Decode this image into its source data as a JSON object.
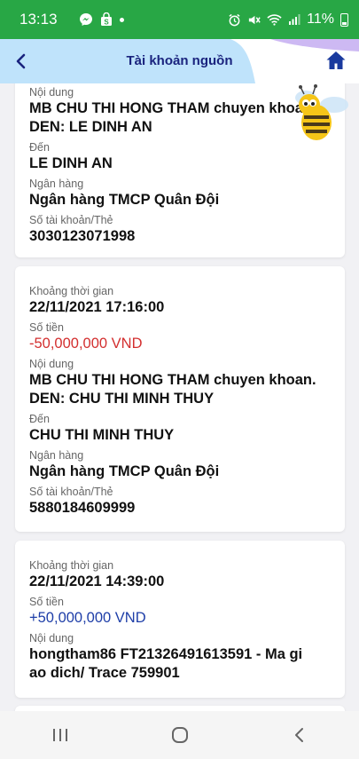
{
  "statusbar": {
    "time": "13:13",
    "battery": "11%",
    "icons": [
      "messenger-icon",
      "bag-icon",
      "dot-icon",
      "alarm-icon",
      "mute-icon",
      "wifi-icon",
      "signal-icon",
      "battery-icon"
    ]
  },
  "header": {
    "title": "Tài khoản nguồn",
    "back_icon": "chevron-left-icon",
    "home_icon": "home-icon"
  },
  "transactions": [
    {
      "content_label": "Nội dung",
      "content": "MB CHU THI HONG THAM chuyen khoan. DEN: LE DINH AN",
      "to_label": "Đến",
      "to": "LE DINH AN",
      "bank_label": "Ngân hàng",
      "bank": "Ngân hàng TMCP Quân Đội",
      "account_label": "Số tài khoản/Thẻ",
      "account": "3030123071998"
    },
    {
      "time_label": "Khoảng thời gian",
      "time": "22/11/2021 17:16:00",
      "amount_label": "Số tiền",
      "amount": "-50,000,000 VND",
      "content_label": "Nội dung",
      "content": "MB CHU THI HONG THAM chuyen khoan. DEN: CHU THI MINH THUY",
      "to_label": "Đến",
      "to": "CHU THI MINH THUY",
      "bank_label": "Ngân hàng",
      "bank": "Ngân hàng TMCP Quân Đội",
      "account_label": "Số tài khoản/Thẻ",
      "account": "5880184609999"
    },
    {
      "time_label": "Khoảng thời gian",
      "time": "22/11/2021 14:39:00",
      "amount_label": "Số tiền",
      "amount": "+50,000,000 VND",
      "content_label": "Nội dung",
      "content": "hongtham86 FT21326491613591 - Ma gi ao dich/ Trace 759901"
    }
  ],
  "colors": {
    "statusbar": "#28a745",
    "title": "#1a237e",
    "negative": "#d32f2f",
    "positive": "#1e3ea8"
  },
  "navbar": {
    "icons": [
      "recents-icon",
      "home-circle-icon",
      "back-icon"
    ]
  }
}
